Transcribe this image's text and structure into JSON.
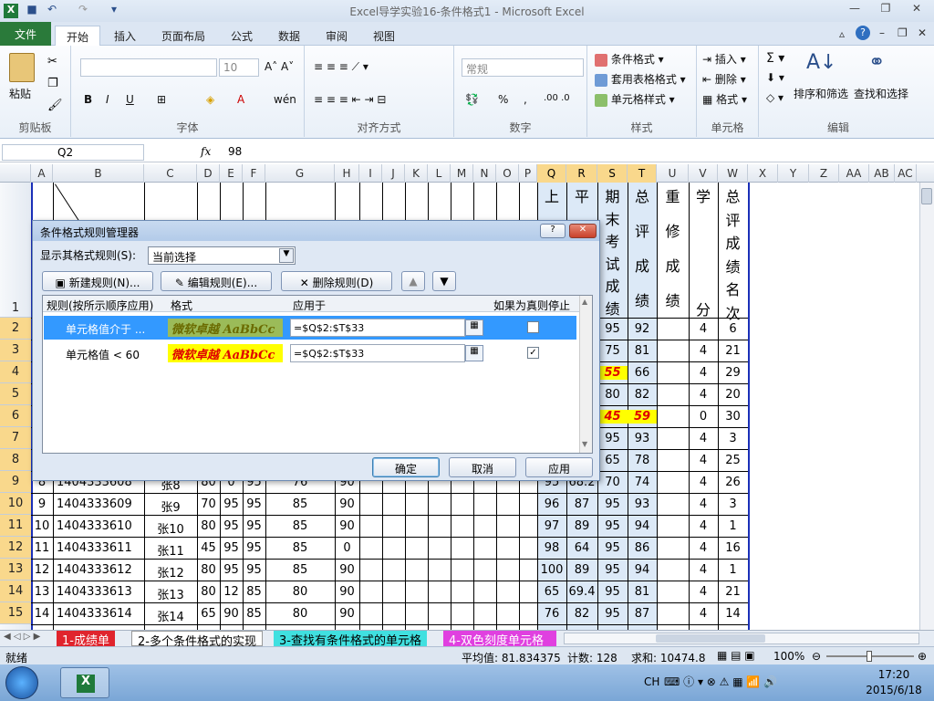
{
  "window": {
    "title": "Excel导学实验16-条件格式1 - Microsoft Excel"
  },
  "tabs": {
    "file": "文件",
    "home": "开始",
    "insert": "插入",
    "layout": "页面布局",
    "formulas": "公式",
    "data": "数据",
    "review": "审阅",
    "view": "视图"
  },
  "ribbon": {
    "clipboard": {
      "label": "剪贴板",
      "paste": "粘贴"
    },
    "font": {
      "label": "字体",
      "size": "10",
      "bold": "B",
      "italic": "I",
      "underline": "U"
    },
    "align": {
      "label": "对齐方式"
    },
    "number": {
      "label": "数字",
      "format": "常规",
      "percent": "%"
    },
    "styles": {
      "label": "样式",
      "cond": "条件格式",
      "table": "套用表格格式",
      "cell": "单元格样式"
    },
    "cells": {
      "label": "单元格",
      "insert": "插入",
      "delete": "删除",
      "format": "格式"
    },
    "edit": {
      "label": "编辑",
      "sort": "排序和筛选",
      "find": "查找和选择"
    }
  },
  "formula_bar": {
    "name_box": "Q2",
    "fx": "fx",
    "value": "98"
  },
  "columns": [
    "A",
    "B",
    "C",
    "D",
    "E",
    "F",
    "G",
    "H",
    "I",
    "J",
    "K",
    "L",
    "M",
    "N",
    "O",
    "P",
    "Q",
    "R",
    "S",
    "T",
    "U",
    "V",
    "W",
    "X",
    "Y",
    "Z",
    "AA",
    "AB",
    "AC"
  ],
  "row_numbers": [
    "1",
    "2",
    "3",
    "4",
    "5",
    "6",
    "7",
    "8",
    "9",
    "10",
    "11",
    "12",
    "13",
    "14",
    "15"
  ],
  "header_texts": {
    "q": "上",
    "r": "平",
    "s": [
      "期",
      "末",
      "考",
      "试",
      "成",
      "绩"
    ],
    "t": [
      "总",
      "评",
      "成",
      "绩"
    ],
    "u": [
      "重",
      "修",
      "成",
      "绩"
    ],
    "v": [
      "学",
      "分"
    ],
    "w": [
      "总",
      "评",
      "成",
      "绩",
      "名",
      "次"
    ]
  },
  "right_rows": [
    [
      "95",
      "92",
      "",
      "4",
      "6"
    ],
    [
      "75",
      "81",
      "",
      "4",
      "21"
    ],
    [
      "55",
      "66",
      "",
      "4",
      "29"
    ],
    [
      "80",
      "82",
      "",
      "4",
      "20"
    ],
    [
      "45",
      "59",
      "",
      "0",
      "30"
    ],
    [
      "95",
      "93",
      "",
      "4",
      "3"
    ],
    [
      "65",
      "78",
      "",
      "4",
      "25"
    ]
  ],
  "lower_rows": [
    [
      "8",
      "1404333608",
      "张8",
      "80",
      "0",
      "95",
      "76",
      "90",
      "95",
      "68.2",
      "70",
      "74",
      "",
      "4",
      "26"
    ],
    [
      "9",
      "1404333609",
      "张9",
      "70",
      "95",
      "95",
      "85",
      "90",
      "96",
      "87",
      "95",
      "93",
      "",
      "4",
      "3"
    ],
    [
      "10",
      "1404333610",
      "张10",
      "80",
      "95",
      "95",
      "85",
      "90",
      "97",
      "89",
      "95",
      "94",
      "",
      "4",
      "1"
    ],
    [
      "11",
      "1404333611",
      "张11",
      "45",
      "95",
      "95",
      "85",
      "0",
      "98",
      "64",
      "95",
      "86",
      "",
      "4",
      "16"
    ],
    [
      "12",
      "1404333612",
      "张12",
      "80",
      "95",
      "95",
      "85",
      "90",
      "100",
      "89",
      "95",
      "94",
      "",
      "4",
      "1"
    ],
    [
      "13",
      "1404333613",
      "张13",
      "80",
      "12",
      "85",
      "80",
      "90",
      "65",
      "69.4",
      "95",
      "81",
      "",
      "4",
      "21"
    ],
    [
      "14",
      "1404333614",
      "张14",
      "65",
      "90",
      "85",
      "80",
      "90",
      "76",
      "82",
      "95",
      "87",
      "",
      "4",
      "14"
    ]
  ],
  "sheet_tabs": [
    "1-成绩单",
    "2-多个条件格式的实现",
    "3-查找有条件格式的单元格",
    "4-双色刻度单元格"
  ],
  "status": {
    "ready": "就绪",
    "average": "平均值: 81.834375",
    "count": "计数: 128",
    "sum": "求和: 10474.8",
    "zoom": "100%"
  },
  "taskbar": {
    "lang": "CH",
    "time": "17:20",
    "date": "2015/6/18"
  },
  "dialog": {
    "title": "条件格式规则管理器",
    "show_label": "显示其格式规则(S):",
    "show_value": "当前选择",
    "new_rule": "新建规则(N)...",
    "edit_rule": "编辑规则(E)...",
    "delete_rule": "删除规则(D)",
    "col_rule": "规则(按所示顺序应用)",
    "col_format": "格式",
    "col_applies": "应用于",
    "col_stop": "如果为真则停止",
    "rules": [
      {
        "rule": "单元格值介于 ...",
        "preview": "微软卓越  AaBbCc",
        "applies": "=$Q$2:$T$33",
        "stop": ""
      },
      {
        "rule": "单元格值 < 60",
        "preview": "微软卓越  AaBbCc",
        "applies": "=$Q$2:$T$33",
        "stop": "✓"
      }
    ],
    "ok": "确定",
    "cancel": "取消",
    "apply": "应用"
  }
}
